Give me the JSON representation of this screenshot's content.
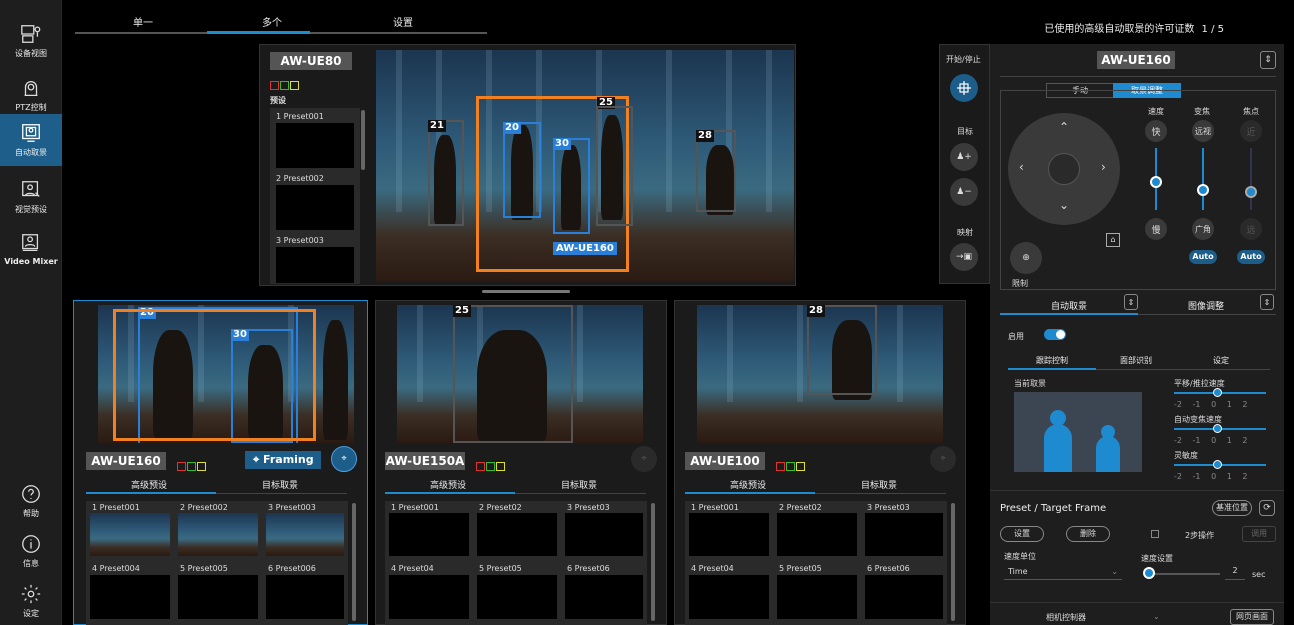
{
  "sidebar": {
    "items": [
      {
        "label": "设备视图",
        "icon": "device-view-icon"
      },
      {
        "label": "PTZ控制",
        "icon": "ptz-camera-icon"
      },
      {
        "label": "自动取景",
        "icon": "auto-framing-icon"
      },
      {
        "label": "视觉预设",
        "icon": "visual-preset-icon"
      },
      {
        "label": "Video Mixer",
        "icon": "video-mixer-icon"
      }
    ],
    "bottom": [
      {
        "label": "帮助",
        "icon": "help-icon"
      },
      {
        "label": "信息",
        "icon": "info-icon"
      },
      {
        "label": "设定",
        "icon": "settings-icon"
      }
    ]
  },
  "top_tabs": [
    "单一",
    "多个",
    "设置"
  ],
  "license": {
    "label": "已使用的高级自动取景的许可证数",
    "value": "1 / 5"
  },
  "main_cam": {
    "name": "AW-UE80",
    "preset_title": "预设",
    "presets": [
      "1  Preset001",
      "2  Preset002",
      "3  Preset003"
    ],
    "labels": {
      "b21": "21",
      "b20": "20",
      "b30": "30",
      "b25": "25",
      "b28": "28",
      "target": "AW-UE160"
    }
  },
  "cams": [
    {
      "name": "AW-UE160",
      "framing": "Framing",
      "tabs": [
        "高级预设",
        "目标取景"
      ],
      "presets": [
        "1  Preset001",
        "2  Preset002",
        "3  Preset003",
        "4  Preset004",
        "5  Preset005",
        "6  Preset006"
      ],
      "labels": {
        "b20": "20",
        "b30": "30"
      }
    },
    {
      "name": "AW-UE150A",
      "tabs": [
        "高级预设",
        "目标取景"
      ],
      "presets": [
        "1  Preset001",
        "2  Preset02",
        "3  Preset03",
        "4  Preset04",
        "5  Preset05",
        "6  Preset06"
      ],
      "labels": {
        "b25": "25"
      }
    },
    {
      "name": "AW-UE100",
      "tabs": [
        "高级预设",
        "目标取景"
      ],
      "presets": [
        "1  Preset001",
        "2  Preset02",
        "3  Preset03",
        "4  Preset04",
        "5  Preset05",
        "6  Preset06"
      ],
      "labels": {
        "b28": "28"
      }
    }
  ],
  "mini_col": {
    "start_stop": "开始/停止",
    "target": "目标",
    "mapping": "映射"
  },
  "right": {
    "cam_name": "AW-UE160",
    "mode_tabs": [
      "手动",
      "取景调整"
    ],
    "speed": "速度",
    "fast": "快",
    "slow": "慢",
    "zoom": "变焦",
    "tele": "远视",
    "wide": "广角",
    "focus": "焦点",
    "near": "近",
    "far": "远",
    "auto": "Auto",
    "limit": "限制",
    "sub_tabs": [
      "自动取景",
      "图像调整"
    ],
    "enable": "启用",
    "tabs3": [
      "跟踪控制",
      "面部识别",
      "设定"
    ],
    "current_framing": "当前取景",
    "pan_speed": "平移/推拉速度",
    "auto_zoom_speed": "自动变焦速度",
    "sensitivity": "灵敏度",
    "scale": [
      "-2",
      "-1",
      "0",
      "1",
      "2"
    ],
    "preset_target": "Preset / Target Frame",
    "ref_pos": "基准位置",
    "set": "设置",
    "delete": "删除",
    "two_step": "2步操作",
    "recall": "调用",
    "speed_unit": "速度单位",
    "speed_unit_val": "Time",
    "speed_setting": "速度设置",
    "speed_val": "2",
    "sec": "sec",
    "cam_controller": "相机控制器",
    "web_screen": "网页画面"
  }
}
